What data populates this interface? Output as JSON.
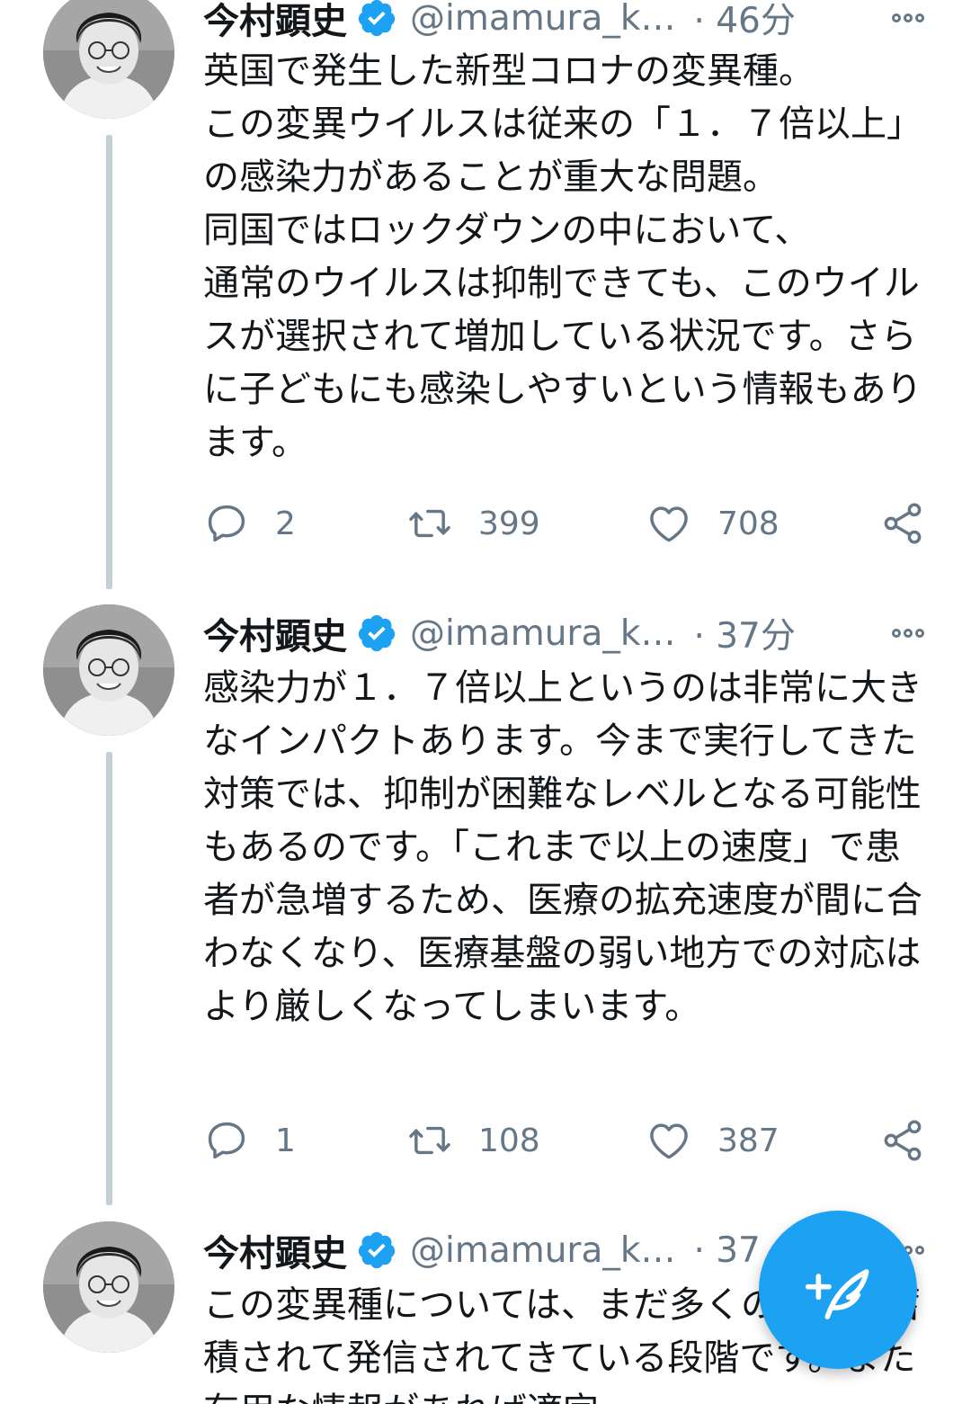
{
  "tweets": [
    {
      "name": "今村顕史",
      "handle": "@imamura_k…",
      "time": "· 46分",
      "text": "英国で発生した新型コロナの変異種。\nこの変異ウイルスは従来の「１．７倍以上」の感染力があることが重大な問題。\n同国ではロックダウンの中において、\n通常のウイルスは抑制できても、このウイルスが選択されて増加している状況です。さらに子どもにも感染しやすいという情報もあります。",
      "replies": "2",
      "retweets": "399",
      "likes": "708"
    },
    {
      "name": "今村顕史",
      "handle": "@imamura_k…",
      "time": "· 37分",
      "text": "感染力が１．７倍以上というのは非常に大きなインパクトあります。今まで実行してきた対策では、抑制が困難なレベルとなる可能性もあるのです。「これまで以上の速度」で患者が急増するため、医療の拡充速度が間に合わなくなり、医療基盤の弱い地方での対応はより厳しくなってしまいます。",
      "replies": "1",
      "retweets": "108",
      "likes": "387"
    },
    {
      "name": "今村顕史",
      "handle": "@imamura_k…",
      "time": "· 37",
      "text": "この変異種については、まだ多くの情報が蓄積されて発信されてきている段階です。また有用な情報があれば適宜"
    }
  ],
  "icons": {
    "verified": "verified-badge-icon",
    "more": "more-options-icon",
    "reply": "reply-icon",
    "retweet": "retweet-icon",
    "like": "like-icon",
    "share": "share-icon",
    "compose": "compose-tweet-icon"
  },
  "colors": {
    "accent": "#1da1f2",
    "text": "#14171a",
    "secondary": "#657786",
    "thread_line": "#c4cfd6"
  }
}
